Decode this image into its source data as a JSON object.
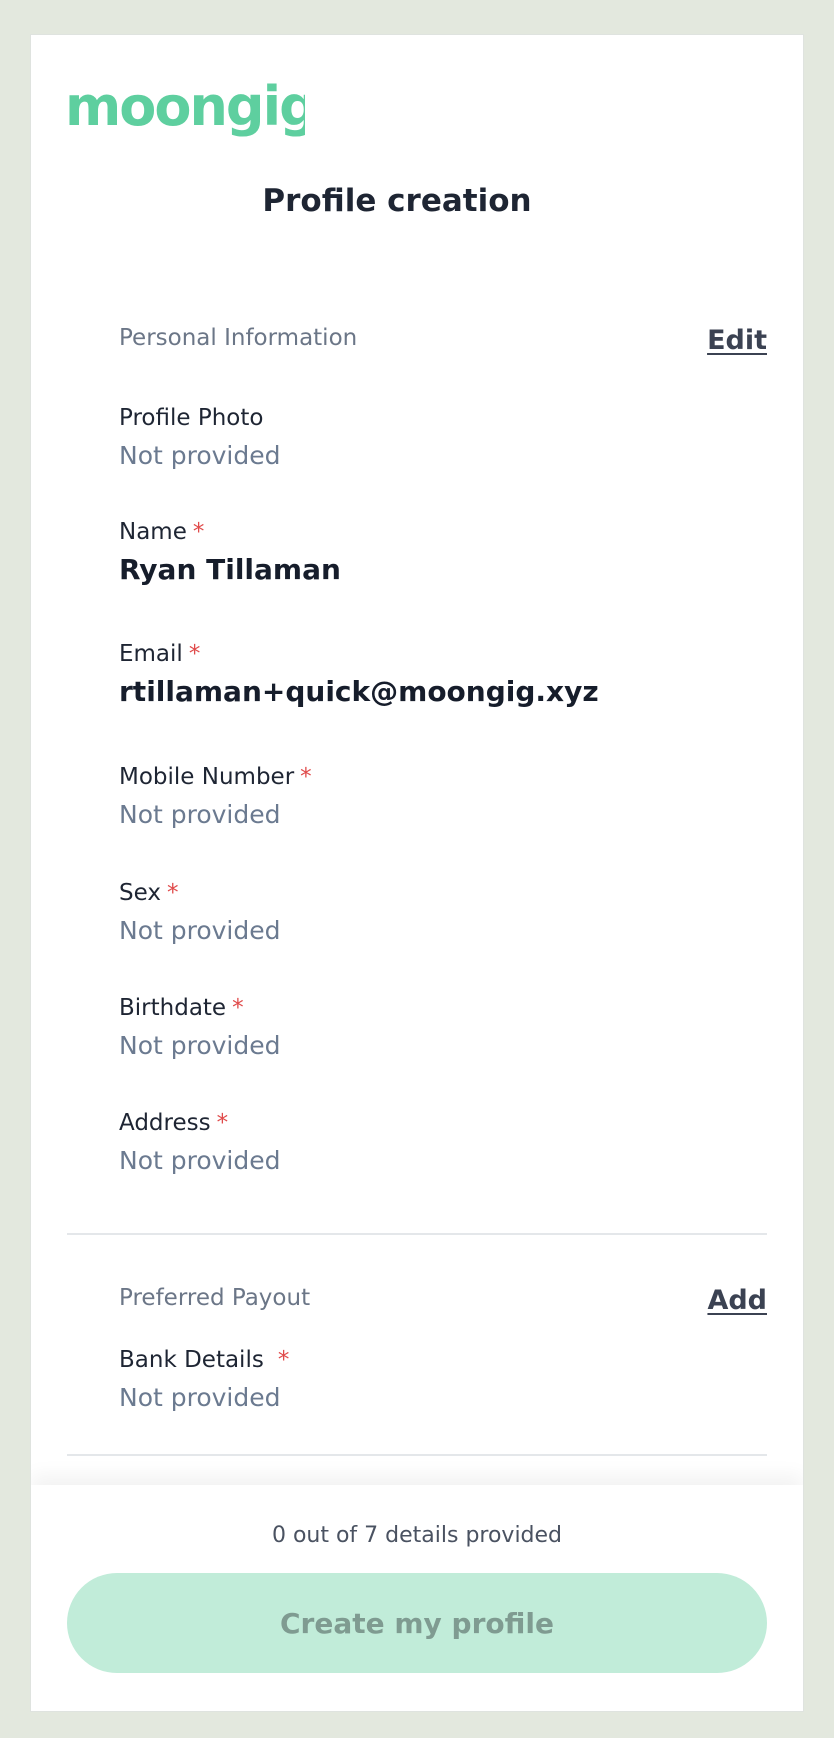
{
  "brand": {
    "logo_text": "moongig",
    "accent_color": "#5ecf9f"
  },
  "header": {
    "title": "Profile creation"
  },
  "personal_info": {
    "heading": "Personal Information",
    "action": "Edit",
    "required_marker": "*",
    "fields": [
      {
        "label": "Profile Photo",
        "value": "Not provided",
        "required": false
      },
      {
        "label": "Name",
        "value": "Ryan Tillaman",
        "required": true
      },
      {
        "label": "Email",
        "value": "rtillaman+quick@moongig.xyz",
        "required": true
      },
      {
        "label": "Mobile Number",
        "value": "Not provided",
        "required": true
      },
      {
        "label": "Sex",
        "value": "Not provided",
        "required": true
      },
      {
        "label": "Birthdate",
        "value": "Not provided",
        "required": true
      },
      {
        "label": "Address",
        "value": "Not provided",
        "required": true
      }
    ]
  },
  "payout": {
    "heading": "Preferred Payout",
    "action": "Add",
    "fields": [
      {
        "label": "Bank Details",
        "value": "Not provided",
        "required": true
      }
    ]
  },
  "footer": {
    "progress_text": "0 out of 7 details provided",
    "create_button_label": "Create my profile",
    "create_button_color": "#c1ecd9"
  }
}
